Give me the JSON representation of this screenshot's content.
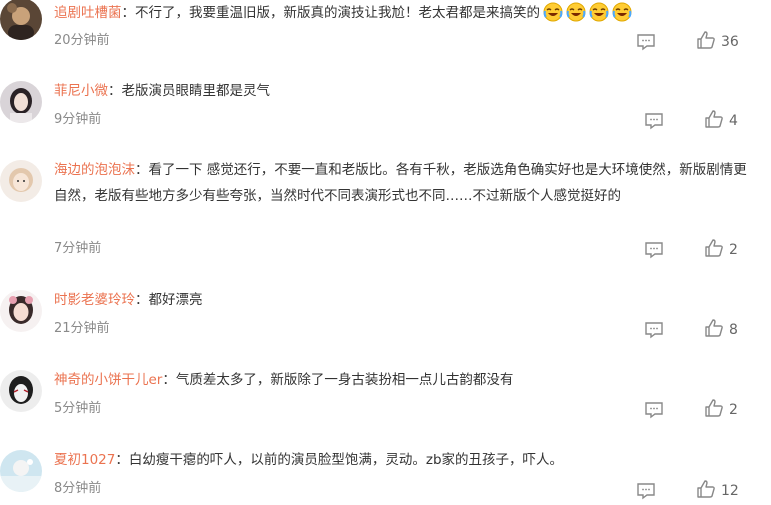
{
  "colors": {
    "username": "#eb7350",
    "text": "#333333",
    "time": "#8a8a8a",
    "icon": "#888888"
  },
  "icons": {
    "reply": "comment-icon",
    "like": "thumbs-up-icon",
    "emoji": "laughing-crying-emoji"
  },
  "comments": [
    {
      "username": "追剧吐槽菌",
      "separator": "：",
      "content": "不行了，我要重温旧版，新版真的演技让我尬！老太君都是来搞笑的",
      "time": "20分钟前",
      "likes": "36"
    },
    {
      "username": "菲尼小微",
      "separator": "：",
      "content": "老版演员眼睛里都是灵气",
      "time": "9分钟前",
      "likes": "4"
    },
    {
      "username": "海边的泡泡沫",
      "separator": "：",
      "content": "看了一下 感觉还行，不要一直和老版比。各有千秋，老版选角色确实好也是大环境使然，新版剧情更自然，老版有些地方多少有些夸张，当然时代不同表演形式也不同……不过新版个人感觉挺好的",
      "time": "7分钟前",
      "likes": "2"
    },
    {
      "username": "时影老婆玲玲",
      "separator": "：",
      "content": "都好漂亮",
      "time": "21分钟前",
      "likes": "8"
    },
    {
      "username": "神奇的小饼干儿er",
      "separator": "：",
      "content": "气质差太多了，新版除了一身古装扮相一点儿古韵都没有",
      "time": "5分钟前",
      "likes": "2"
    },
    {
      "username": "夏初1027",
      "separator": "：",
      "content": "白幼瘦干瘪的吓人，以前的演员脸型饱满，灵动。zb家的丑孩子，吓人。",
      "time": "8分钟前",
      "likes": "12"
    }
  ]
}
